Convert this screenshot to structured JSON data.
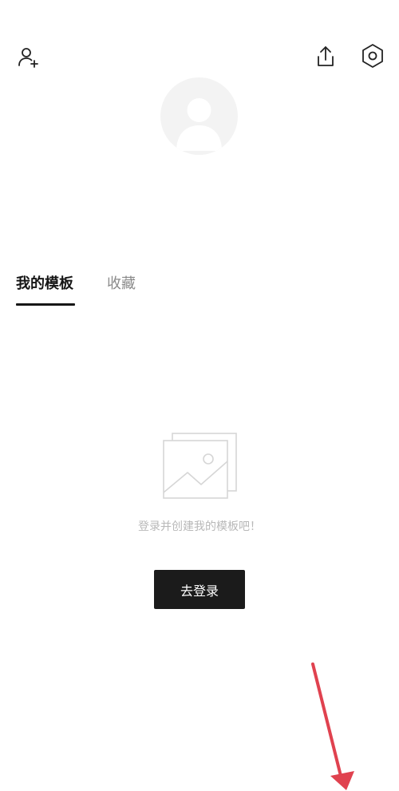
{
  "header": {
    "icons": {
      "add_friend": "add-user-icon",
      "share": "share-icon",
      "settings": "settings-hexagon-icon"
    }
  },
  "profile": {
    "avatar_icon": "default-avatar-icon"
  },
  "tabs": [
    {
      "label": "我的模板",
      "active": true
    },
    {
      "label": "收藏",
      "active": false
    }
  ],
  "empty_state": {
    "icon": "image-placeholder-icon",
    "message": "登录并创建我的模板吧！",
    "button_label": "去登录"
  },
  "colors": {
    "primary_text": "#161616",
    "inactive_tab": "#8a8a8a",
    "muted_text": "#b8b8b8",
    "button_bg": "#1b1b1b",
    "annotation": "#e0424f"
  }
}
